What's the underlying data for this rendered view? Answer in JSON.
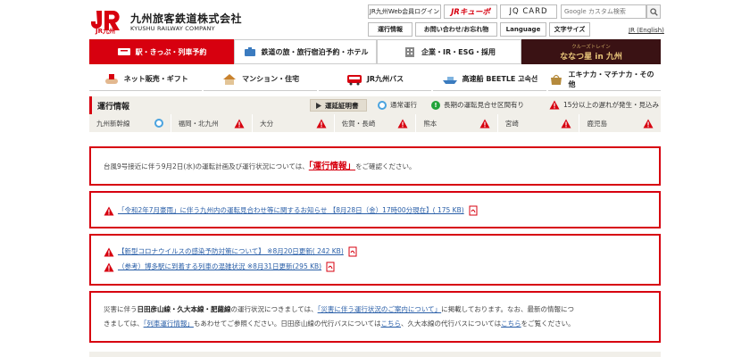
{
  "header": {
    "logo_mark": "JR",
    "logo_sub": "JR九州",
    "company_name": "九州旅客鉄道株式会社",
    "company_name_en": "KYUSHU RAILWAY COMPANY",
    "member_login": "JR九州Web会員ログイン",
    "jr_kyupo": "JRキューポ",
    "jq_card": "JQ CARD",
    "search_placeholder": "Google カスタム検索",
    "operation_info": "運行情報",
    "inquiry": "お問い合わせ/お忘れ物",
    "language": "Language",
    "font_size": "文字サイズ",
    "english": "JR (English)"
  },
  "nav": {
    "row1": [
      {
        "label": "駅・きっぷ・列車予約"
      },
      {
        "label": "鉄道の旅・旅行宿泊予約・ホテル"
      },
      {
        "label": "企業・IR・ESG・採用"
      }
    ],
    "train_label": "ななつ星 in 九州",
    "train_sublabel": "クルーズトレイン",
    "row2": [
      {
        "label": "ネット販売・ギフト"
      },
      {
        "label": "マンション・住宅"
      },
      {
        "label": "JR九州バス"
      },
      {
        "label": "高速船 BEETLE 고속선"
      },
      {
        "label": "エキナカ・マチナカ・その他"
      }
    ]
  },
  "operation": {
    "title": "運行情報",
    "explain_button": "運延証明書",
    "legend_normal": "通常運行",
    "legend_long_stop": "長期の運転見合せ区間有り",
    "legend_delay": "15分以上の遅れが発生・見込み",
    "regions": [
      {
        "name": "九州新幹線",
        "status": "normal"
      },
      {
        "name": "福岡・北九州",
        "status": "warn"
      },
      {
        "name": "大分",
        "status": "warn"
      },
      {
        "name": "佐賀・長崎",
        "status": "warn"
      },
      {
        "name": "熊本",
        "status": "warn"
      },
      {
        "name": "宮崎",
        "status": "warn"
      },
      {
        "name": "鹿児島",
        "status": "warn"
      }
    ]
  },
  "notices": {
    "n1_before": "台風9号接近に伴う9月2日(水)の運転計画及び運行状況については、",
    "n1_link": "「運行情報」",
    "n1_after": "をご確認ください。",
    "n2_link": "「令和2年7月豪雨」に伴う九州内の運転見合わせ等に関するお知らせ 【8月28日（金）17時00分現在】( 175 KB)",
    "n3_link1": "【新型コロナウイルスの感染予防対策について】 ※8月20日更新( 242 KB)",
    "n3_link2": "（参考）博多駅に到着する列車の混雑状況 ※8月31日更新(295 KB)",
    "n4_t1": "災害に伴う",
    "n4_bold": "日田彦山線・久大本線・肥薩線",
    "n4_t2": "の運行状況につきましては、",
    "n4_link1": "「災害に伴う運行状況のご案内について」",
    "n4_t3": "に掲載しております。なお、最新の情報につ",
    "n4_t4": "きましては、",
    "n4_link2": "「列車運行情報」",
    "n4_t5": "もあわせてご参照ください。日田彦山線の代行バスについては",
    "n4_link3": "こちら",
    "n4_t6": "、久大本線の代行バスについては",
    "n4_link4": "こちら",
    "n4_t7": "をご覧ください。"
  },
  "colors": {
    "brand_red": "#d7000f",
    "normal_blue": "#4aa3df",
    "long_stop_green": "#22a33a",
    "warn_red": "#d7000f"
  }
}
